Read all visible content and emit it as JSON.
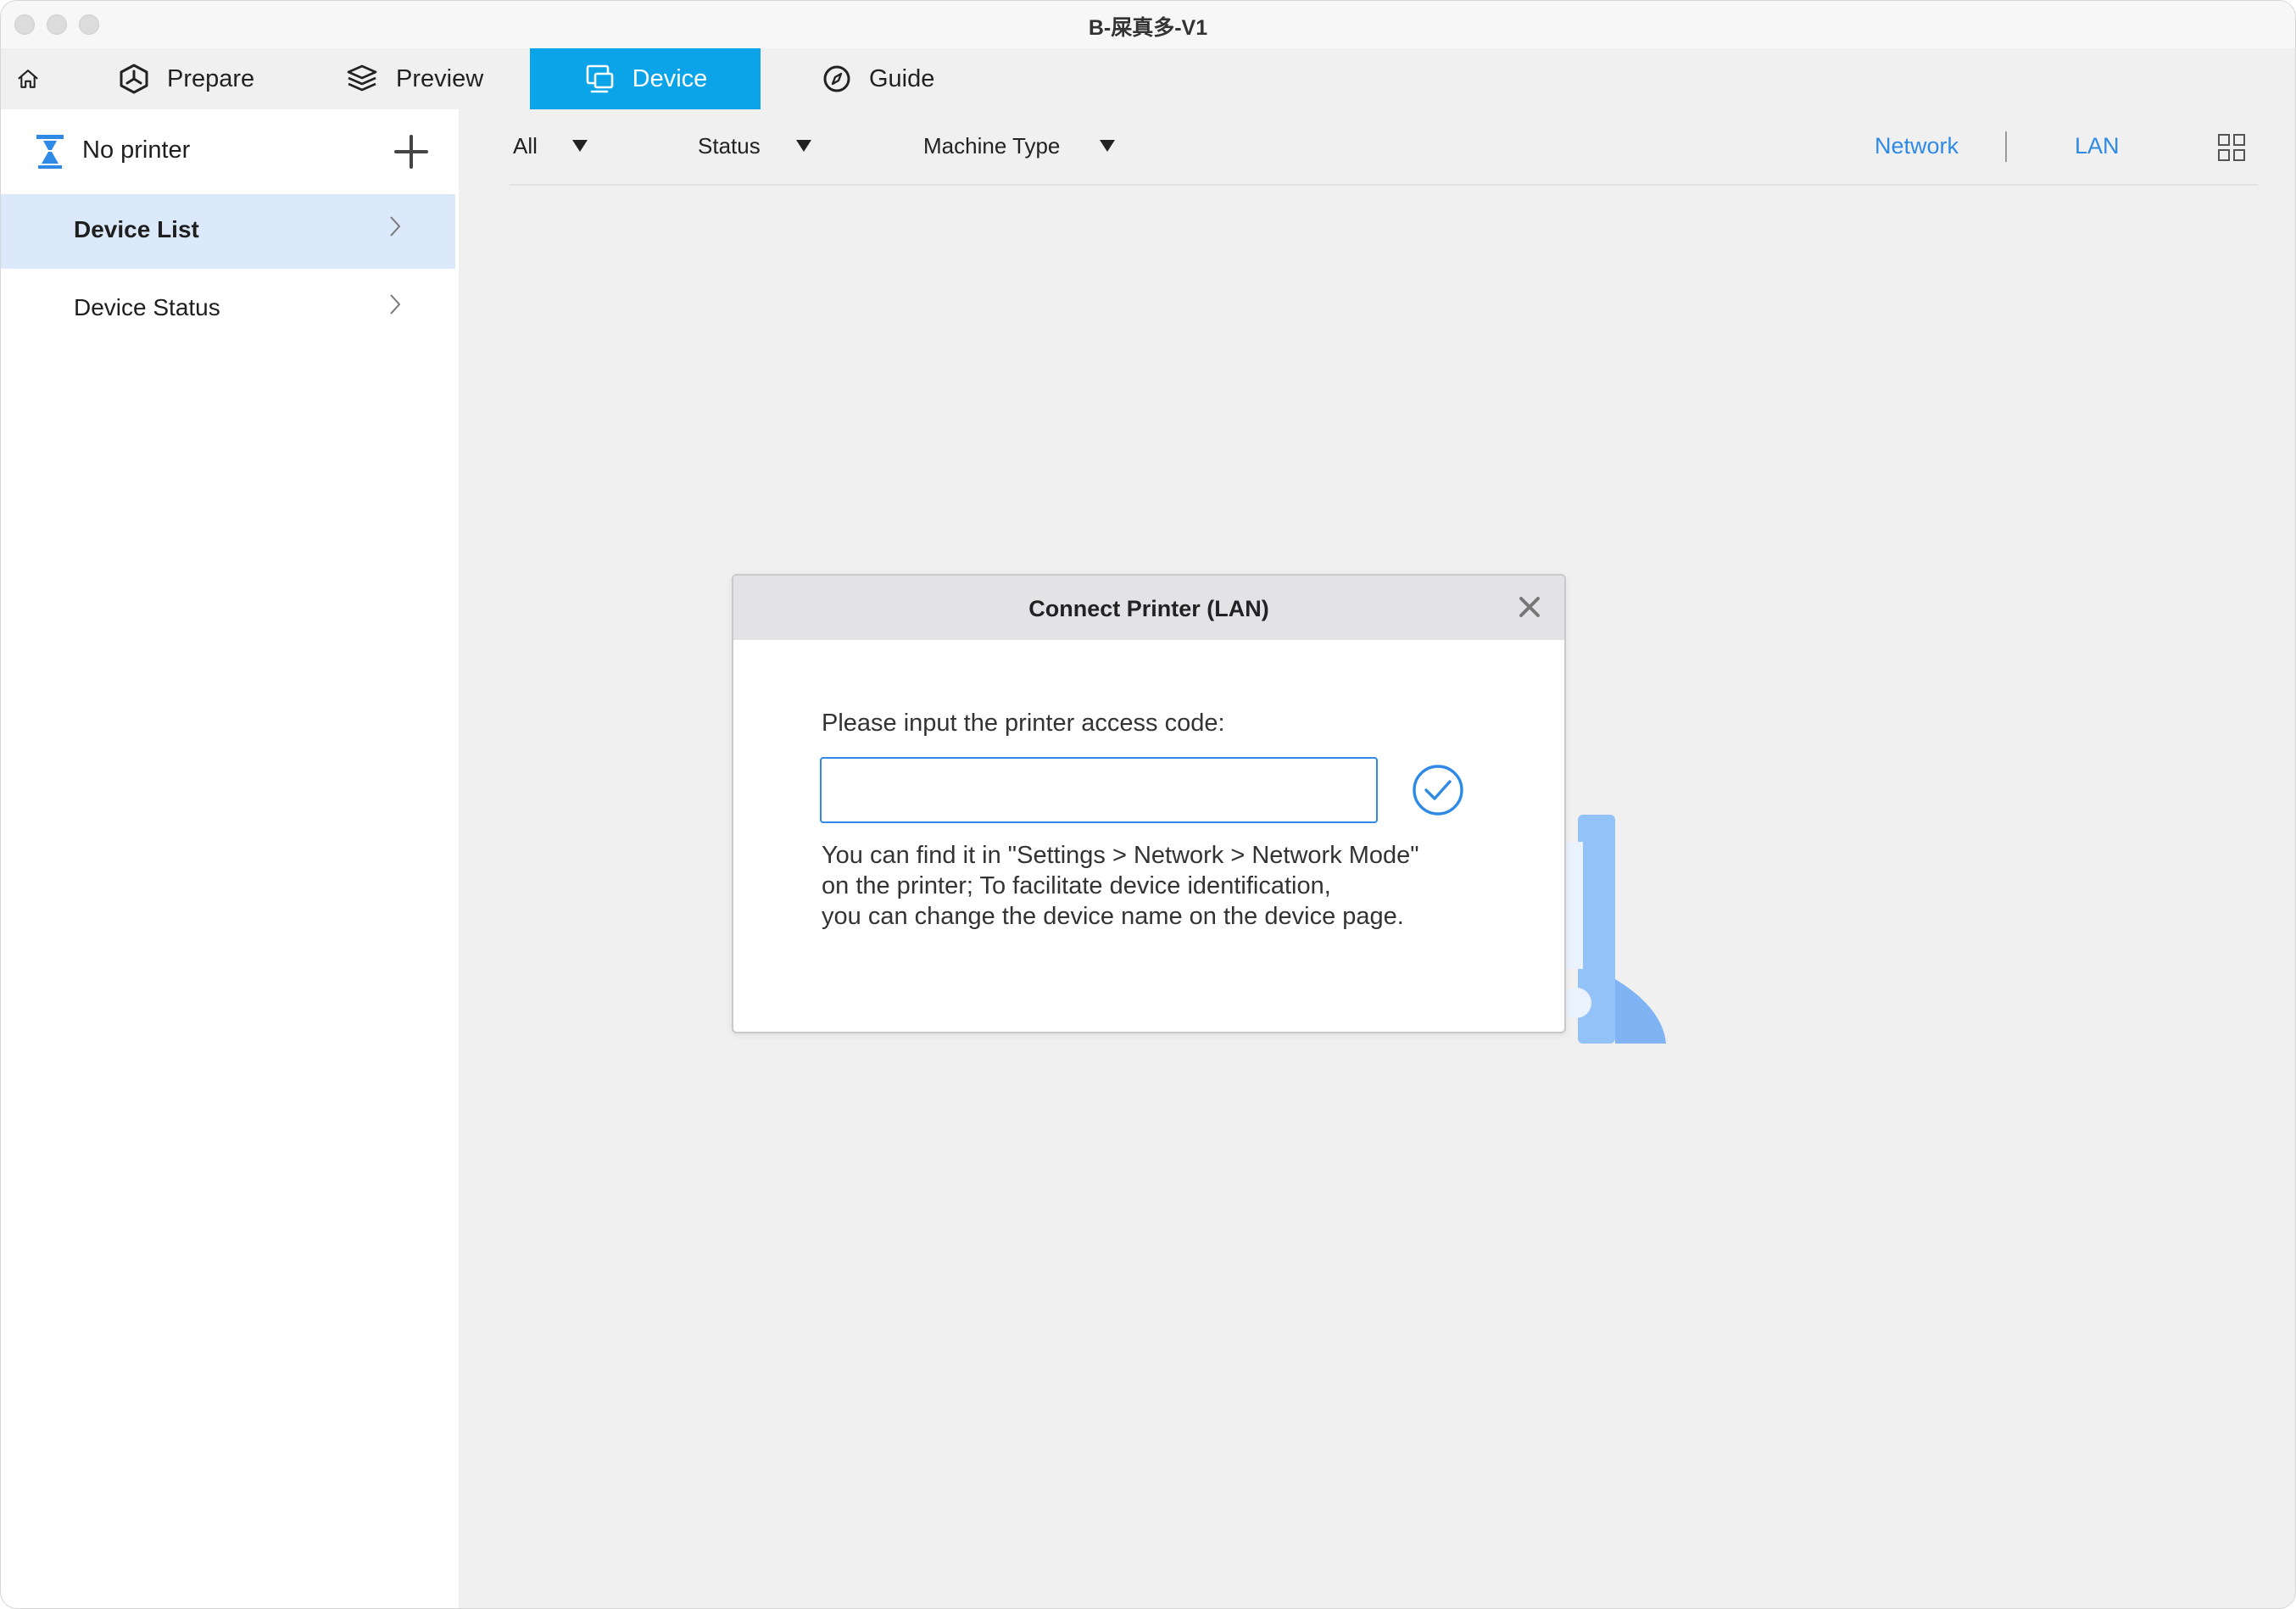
{
  "window": {
    "title": "B-屎真多-V1"
  },
  "tabs": [
    {
      "label": "",
      "icon": "home-icon",
      "active": false
    },
    {
      "label": "Prepare",
      "icon": "prepare-cube-icon",
      "active": false
    },
    {
      "label": "Preview",
      "icon": "layers-icon",
      "active": false
    },
    {
      "label": "Device",
      "icon": "device-monitor-icon",
      "active": true
    },
    {
      "label": "Guide",
      "icon": "compass-icon",
      "active": false
    }
  ],
  "sidebar": {
    "printer_label": "No printer",
    "items": [
      {
        "label": "Device List",
        "active": true
      },
      {
        "label": "Device Status",
        "active": false
      }
    ]
  },
  "filters": {
    "all": "All",
    "status": "Status",
    "machine_type": "Machine Type"
  },
  "connection": {
    "network": "Network",
    "lan": "LAN"
  },
  "dialog": {
    "title": "Connect Printer (LAN)",
    "prompt": "Please input the printer access code:",
    "input_value": "",
    "help_lines": [
      "You can find it in \"Settings > Network > Network Mode\"",
      "on the printer; To facilitate device identification,",
      "you can change the device name on the device page."
    ]
  },
  "colors": {
    "accent": "#0ba4e8",
    "link": "#2f8ae5",
    "sidebar_active": "#dbe9fb",
    "illustration": "#8fc0f7"
  }
}
